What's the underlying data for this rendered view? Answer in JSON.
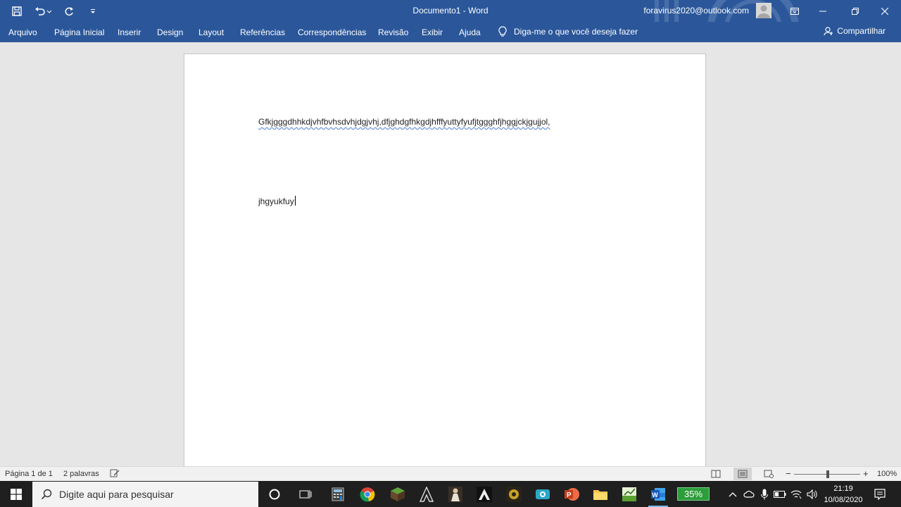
{
  "window": {
    "title": "Documento1  -  Word",
    "account": "foravirus2020@outlook.com"
  },
  "ribbon": {
    "tabs": [
      "Arquivo",
      "Página Inicial",
      "Inserir",
      "Design",
      "Layout",
      "Referências",
      "Correspondências",
      "Revisão",
      "Exibir",
      "Ajuda"
    ],
    "tell_me": "Diga-me o que você deseja fazer",
    "share": "Compartilhar"
  },
  "document": {
    "paragraph1": "Gfkjgggdhhkdjvhfbvhsdvhjdgjvhj,dfjghdgfhkgdjhfffyuttyfyufjtggghfjhggjckjgujjol,",
    "paragraph2": "jhgyukfuy"
  },
  "statusbar": {
    "page": "Página 1 de 1",
    "words": "2 palavras",
    "zoom": "100%",
    "zoom_minus": "−",
    "zoom_plus": "+",
    "zoom_level": 1.0
  },
  "taskbar": {
    "search_placeholder": "Digite aqui para pesquisar",
    "battery_overlay": "35%",
    "time": "21:19",
    "date": "10/08/2020"
  },
  "colors": {
    "accent": "#2b579a",
    "page": "#ffffff",
    "canvas": "#e6e6e6",
    "taskbar": "#1f1f1f"
  }
}
